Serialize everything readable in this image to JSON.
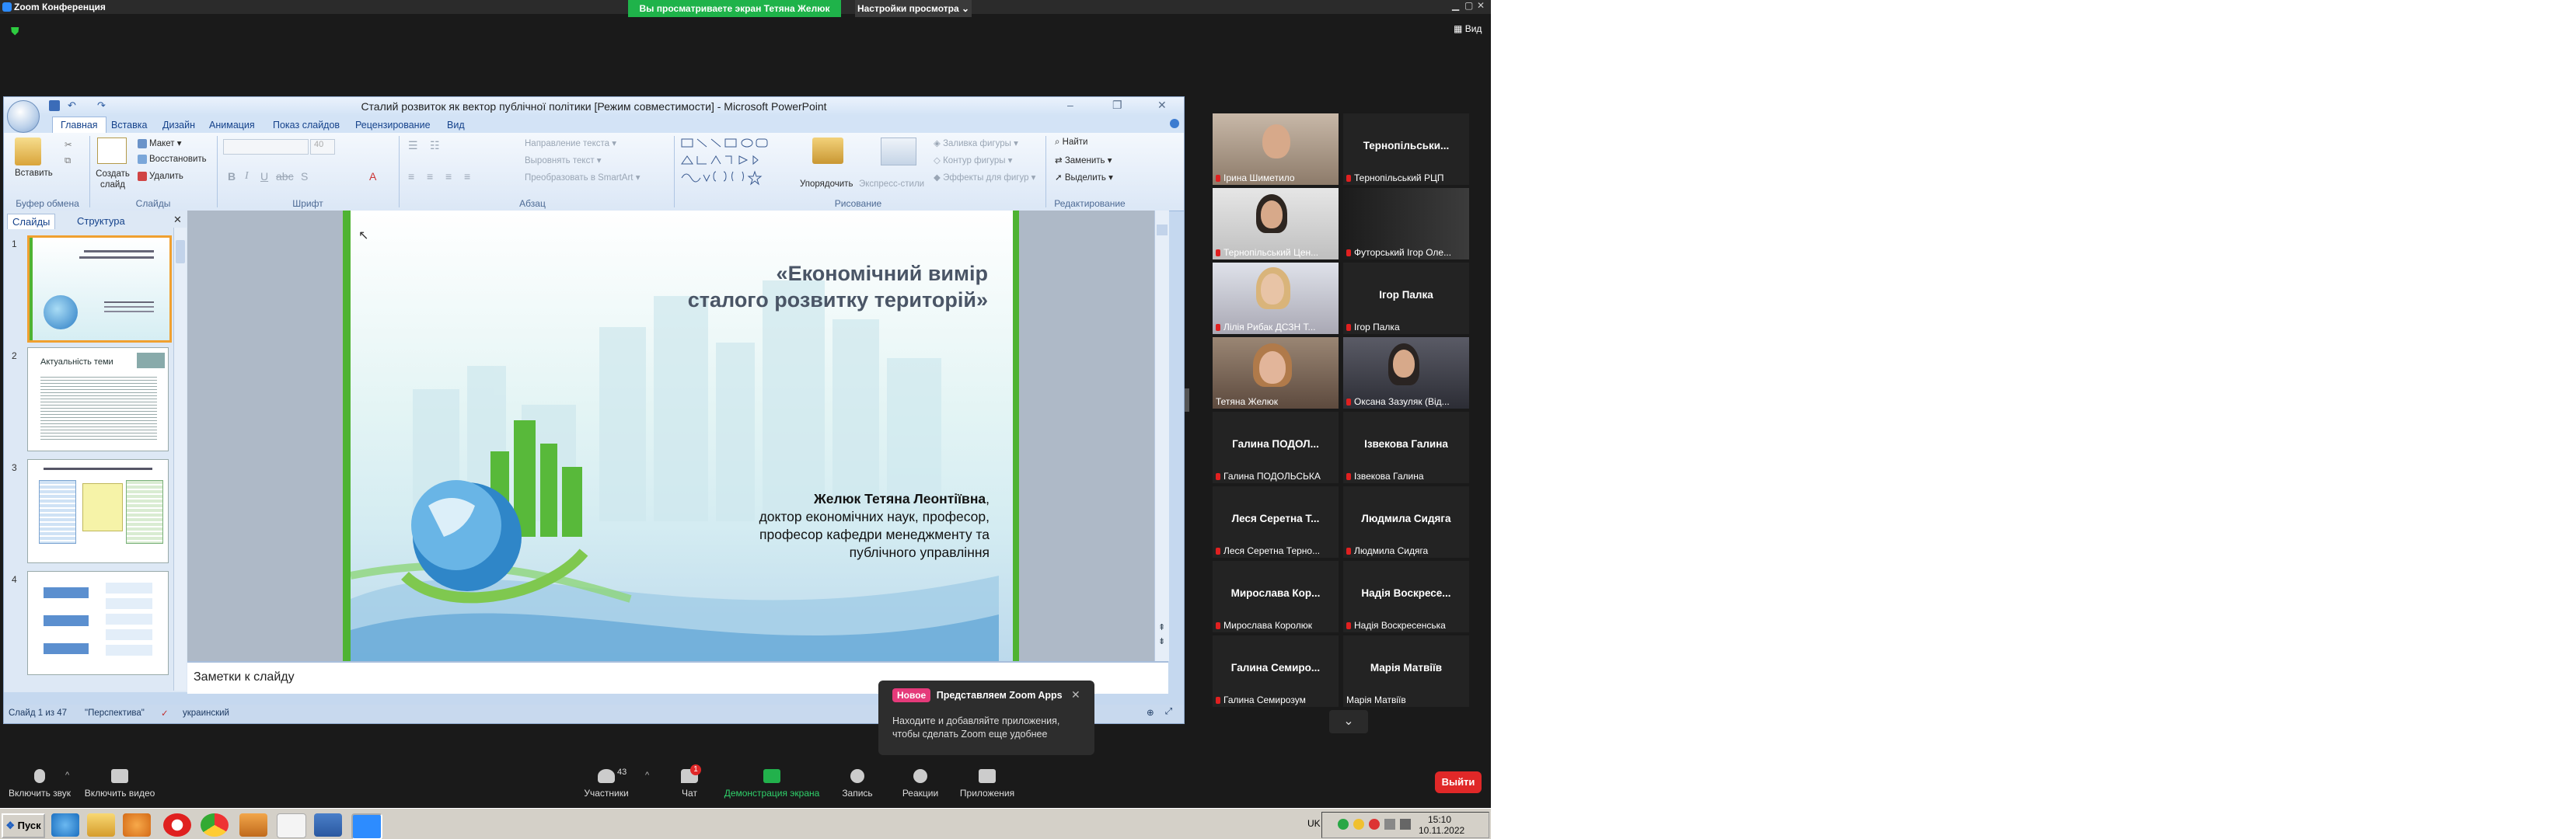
{
  "zoom": {
    "title": "Zoom Конференция",
    "share_banner": "Вы просматриваете экран Тетяна Желюк",
    "view_options": "Настройки просмотра",
    "view_button": "Вид",
    "popup": {
      "badge": "Новое",
      "title": "Представляем Zoom Apps",
      "text": "Находите и добавляйте приложения, чтобы сделать Zoom еще удобнее"
    },
    "participants_count": "43",
    "chat_badge": "1",
    "toolbar": {
      "audio": "Включить звук",
      "video": "Включить видео",
      "participants": "Участники",
      "chat": "Чат",
      "share": "Демонстрация экрана",
      "record": "Запись",
      "reactions": "Реакции",
      "apps": "Приложения",
      "leave": "Выйти"
    },
    "tiles": [
      {
        "label": "Ірина Шиметило",
        "big": "",
        "video": true
      },
      {
        "label": "Тернопільський РЦП",
        "big": "Тернопільськи...",
        "video": false
      },
      {
        "label": "Тернопільський Цен...",
        "big": "",
        "video": true
      },
      {
        "label": "Футорський Ігор Оле...",
        "big": "",
        "video": true
      },
      {
        "label": "Лілія Рибак ДСЗН Т...",
        "big": "",
        "video": true
      },
      {
        "label": "Ігор Палка",
        "big": "Ігор Палка",
        "video": false
      },
      {
        "label": "Тетяна Желюк",
        "big": "",
        "video": true
      },
      {
        "label": "Оксана Зазуляк (Від...",
        "big": "",
        "video": true
      },
      {
        "label": "Галина ПОДОЛЬСЬКА",
        "big": "Галина ПОДОЛ...",
        "video": false
      },
      {
        "label": "Ізвекова Галина",
        "big": "Ізвекова Галина",
        "video": false
      },
      {
        "label": "Леся Серетна Терно...",
        "big": "Леся Серетна Т...",
        "video": false
      },
      {
        "label": "Людмила Сидяга",
        "big": "Людмила Сидяга",
        "video": false
      },
      {
        "label": "Мирослава Королюк",
        "big": "Мирослава Кор...",
        "video": false
      },
      {
        "label": "Надія Воскресенська",
        "big": "Надія Воскресе...",
        "video": false
      },
      {
        "label": "Галина Семирозум",
        "big": "Галина Семиро...",
        "video": false
      },
      {
        "label": "Марія Матвіїв",
        "big": "Марія Матвіїв",
        "video": false
      }
    ]
  },
  "ppt": {
    "title": "Сталий розвиток як вектор публічної політики [Режим совместимости] - Microsoft PowerPoint",
    "tabs": [
      "Главная",
      "Вставка",
      "Дизайн",
      "Анимация",
      "Показ слайдов",
      "Рецензирование",
      "Вид"
    ],
    "ribbon": {
      "paste": "Вставить",
      "create_slide": "Создать слайд",
      "layout": "Макет",
      "restore": "Восстановить",
      "delete": "Удалить",
      "font_size": "40",
      "text_dir": "Направление текста",
      "align_text": "Выровнять текст",
      "smartart": "Преобразовать в SmartArt",
      "arrange": "Упорядочить",
      "quick_styles": "Экспресс-стили",
      "shape_fill": "Заливка фигуры",
      "shape_outline": "Контур фигуры",
      "shape_effects": "Эффекты для фигур",
      "find": "Найти",
      "replace": "Заменить",
      "select": "Выделить",
      "groups": [
        "Буфер обмена",
        "Слайды",
        "Шрифт",
        "Абзац",
        "Рисование",
        "Редактирование"
      ]
    },
    "pane_tabs": [
      "Слайды",
      "Структура"
    ],
    "slide": {
      "title_line1": "«Економічний вимір",
      "title_line2": "сталого розвитку територій»",
      "author": "Желюк Тетяна Леонтіївна",
      "author_comma": ",",
      "line1": "доктор економічних наук, професор,",
      "line2": "професор кафедри менеджменту та",
      "line3": "публічного управління"
    },
    "thumb2_title": "Актуальність теми",
    "notes": "Заметки к слайду",
    "status": {
      "slide": "Слайд 1 из 47",
      "theme": "\"Перспектива\"",
      "lang": "украинский"
    }
  },
  "taskbar": {
    "start": "Пуск",
    "lang": "UK",
    "time": "15:10",
    "date": "10.11.2022"
  }
}
